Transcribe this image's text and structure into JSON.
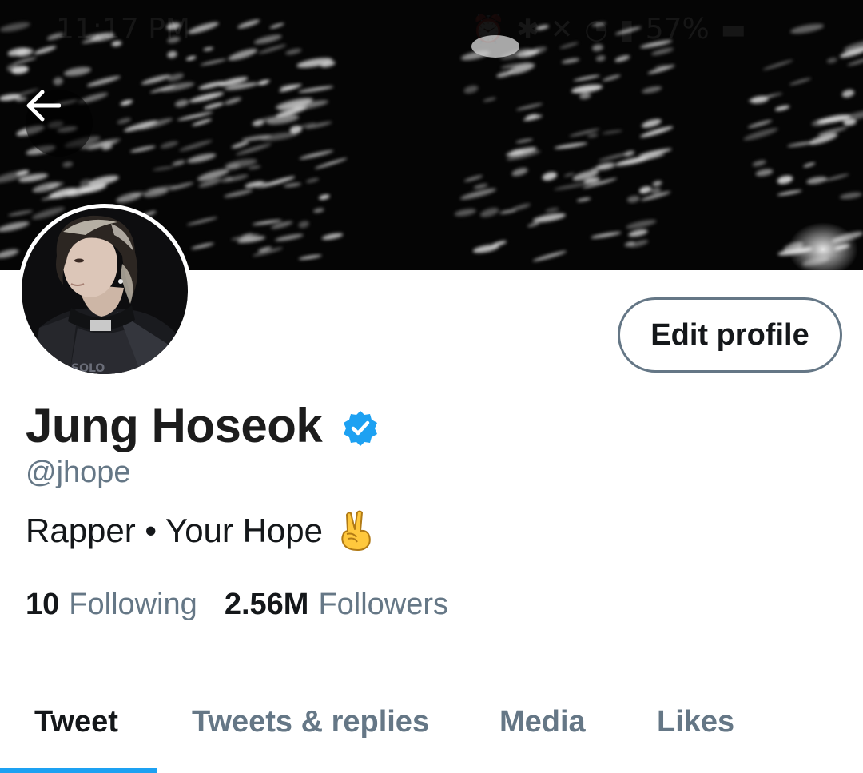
{
  "status_bar": {
    "time": "11:17 PM",
    "battery": "57%"
  },
  "profile": {
    "display_name": "Jung Hoseok",
    "handle": "@jhope",
    "bio": "Rapper • Your Hope",
    "edit_button_label": "Edit profile"
  },
  "stats": {
    "following_count": "10",
    "following_label": "Following",
    "followers_count": "2.56M",
    "followers_label": "Followers"
  },
  "tabs": [
    {
      "label": "Tweet",
      "active": true
    },
    {
      "label": "Tweets & replies",
      "active": false
    },
    {
      "label": "Media",
      "active": false
    },
    {
      "label": "Likes",
      "active": false
    }
  ],
  "colors": {
    "accent": "#1da1f2",
    "secondary_text": "#657786",
    "primary_text": "#14171a",
    "banner_bg": "#050505"
  },
  "icons": {
    "back": "arrow-left-icon",
    "verified": "verified-badge-icon",
    "bio_emoji": "victory-hand-icon"
  }
}
